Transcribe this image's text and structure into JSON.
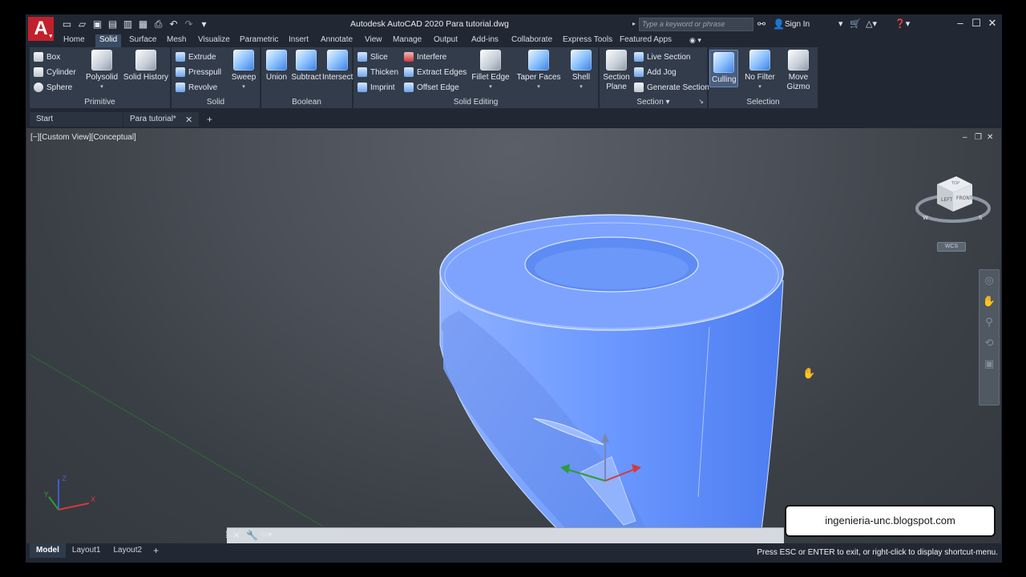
{
  "titlebar": {
    "logo_letter": "A",
    "window_title": "Autodesk AutoCAD 2020   Para tutorial.dwg",
    "search_placeholder": "Type a keyword or phrase",
    "sign_in": "Sign In"
  },
  "ribbon_tabs": [
    "Home",
    "Solid",
    "Surface",
    "Mesh",
    "Visualize",
    "Parametric",
    "Insert",
    "Annotate",
    "View",
    "Manage",
    "Output",
    "Add-ins",
    "Collaborate",
    "Express Tools",
    "Featured Apps"
  ],
  "ribbon_active_tab": "Solid",
  "panels": {
    "primitive": {
      "label": "Primitive",
      "box": "Box",
      "cylinder": "Cylinder",
      "sphere": "Sphere",
      "polysolid": "Polysolid",
      "solid_history": "Solid History"
    },
    "solid": {
      "label": "Solid",
      "extrude": "Extrude",
      "presspull": "Presspull",
      "revolve": "Revolve",
      "sweep": "Sweep"
    },
    "boolean": {
      "label": "Boolean",
      "union": "Union",
      "subtract": "Subtract",
      "intersect": "Intersect"
    },
    "solid_editing": {
      "label": "Solid Editing",
      "slice": "Slice",
      "thicken": "Thicken",
      "imprint": "Imprint",
      "interfere": "Interfere",
      "extract_edges": "Extract Edges",
      "offset_edge": "Offset Edge",
      "fillet_edge": "Fillet Edge",
      "taper_faces": "Taper Faces",
      "shell": "Shell"
    },
    "section": {
      "label": "Section",
      "section_plane_1": "Section",
      "section_plane_2": "Plane",
      "live_section": "Live Section",
      "add_jog": "Add Jog",
      "generate_section": "Generate Section"
    },
    "selection": {
      "label": "Selection",
      "culling": "Culling",
      "no_filter": "No Filter",
      "move_gizmo_1": "Move",
      "move_gizmo_2": "Gizmo"
    }
  },
  "doc_tabs": {
    "start": "Start",
    "file": "Para tutorial*"
  },
  "viewport": {
    "view_label": "[−][Custom View][Conceptual]",
    "viewcube": {
      "left": "LEFT",
      "front": "FRONT",
      "top": "TOP",
      "w": "W",
      "s": "S"
    },
    "wcs": "WCS"
  },
  "ucs": {
    "x": "X",
    "y": "Y",
    "z": "Z"
  },
  "watermark": "ingenieria-unc.blogspot.com",
  "layout_tabs": [
    "Model",
    "Layout1",
    "Layout2"
  ],
  "status_message": "Press ESC or ENTER to exit, or right-click to display shortcut-menu.",
  "colors": {
    "app_red": "#c1212c",
    "ribbon": "#323c4b",
    "frame": "#212833",
    "solid_blue": "#5b8dff"
  }
}
